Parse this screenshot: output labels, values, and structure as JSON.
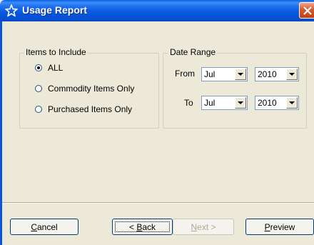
{
  "window": {
    "title": "Usage Report",
    "icon": "star-outline-icon",
    "close": "close-icon"
  },
  "items_group": {
    "label": "Items to Include",
    "options": [
      {
        "label": "ALL",
        "checked": true
      },
      {
        "label": "Commodity Items Only",
        "checked": false
      },
      {
        "label": "Purchased Items Only",
        "checked": false
      }
    ]
  },
  "date_group": {
    "label": "Date Range",
    "from_label": "From",
    "to_label": "To",
    "from_month": "Jul",
    "from_year": "2010",
    "to_month": "Jul",
    "to_year": "2010"
  },
  "buttons": {
    "cancel": {
      "text": "Cancel",
      "mnemonic": "C",
      "rest": "ancel"
    },
    "back": {
      "text": "< Back",
      "prefix": "< ",
      "mnemonic": "B",
      "rest": "ack"
    },
    "next": {
      "text": "Next >",
      "mnemonic": "N",
      "rest": "ext >"
    },
    "preview": {
      "text": "Preview",
      "mnemonic": "P",
      "rest": "review"
    }
  }
}
